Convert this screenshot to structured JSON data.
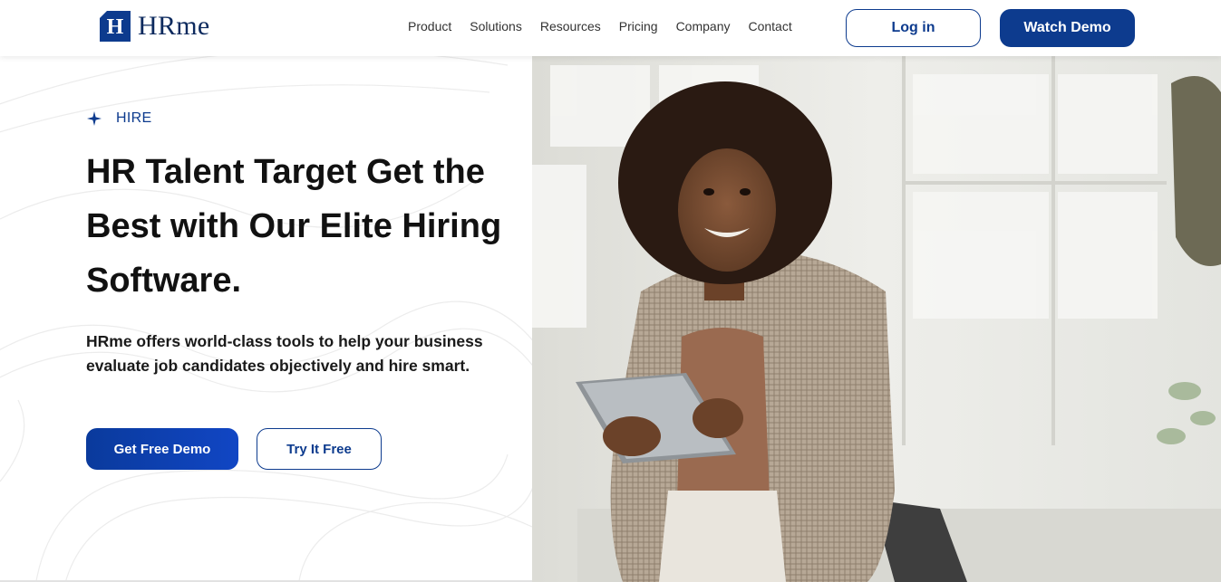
{
  "brand": {
    "name": "HRme",
    "mark": "H",
    "color": "#0d3b8e"
  },
  "nav": {
    "items": [
      "Product",
      "Solutions",
      "Resources",
      "Pricing",
      "Company",
      "Contact"
    ]
  },
  "header": {
    "login_label": "Log in",
    "watch_demo_label": "Watch Demo"
  },
  "hero": {
    "eyebrow": "HIRE",
    "eyebrow_icon": "sparkle-icon",
    "headline_line1": "HR Talent Target Get the",
    "headline_line2": "Best with Our Elite Hiring",
    "headline_line3": "Software.",
    "subtext": "HRme offers world-class tools to help your business evaluate job candidates objectively and hire smart.",
    "primary_cta": "Get Free Demo",
    "secondary_cta": "Try It Free",
    "image": "woman-holding-tablet-photo"
  }
}
